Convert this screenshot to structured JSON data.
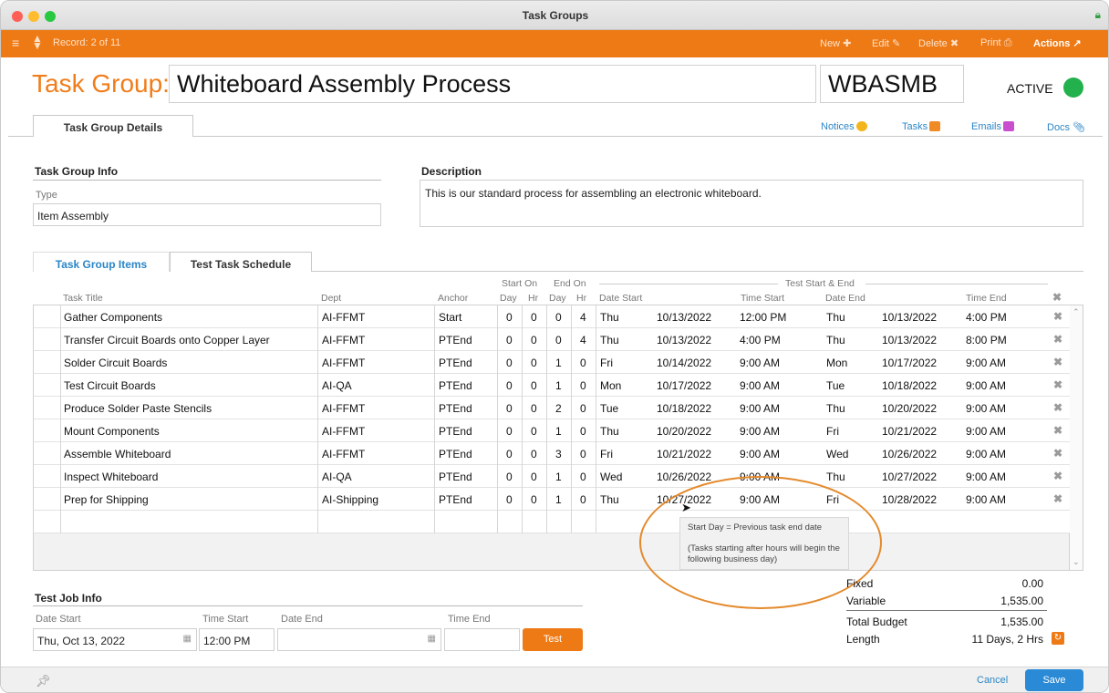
{
  "window": {
    "title": "Task Groups"
  },
  "toolbar": {
    "record": "Record: 2 of 11",
    "new": "New",
    "edit": "Edit",
    "delete": "Delete",
    "print": "Print",
    "actions": "Actions"
  },
  "header": {
    "label": "Task Group:",
    "name": "Whiteboard Assembly Process",
    "code": "WBASMB",
    "status": "ACTIVE",
    "status_color": "#22b14c"
  },
  "tabs": {
    "details": "Task Group Details"
  },
  "links": {
    "notices": "Notices",
    "tasks": "Tasks",
    "emails": "Emails",
    "docs": "Docs"
  },
  "info": {
    "section": "Task Group Info",
    "type_label": "Type",
    "type_value": "Item Assembly"
  },
  "description": {
    "section": "Description",
    "text": "This is our standard process for assembling an electronic whiteboard."
  },
  "subtabs": {
    "items": "Task Group Items",
    "schedule": "Test Task Schedule"
  },
  "grid": {
    "group_start": "Start On",
    "group_end": "End On",
    "group_test": "Test Start & End",
    "columns": {
      "title": "Task Title",
      "dept": "Dept",
      "anchor": "Anchor",
      "sday": "Day",
      "shr": "Hr",
      "eday": "Day",
      "ehr": "Hr",
      "date_start": "Date Start",
      "time_start": "Time Start",
      "date_end": "Date End",
      "time_end": "Time End"
    },
    "rows": [
      {
        "title": "Gather Components",
        "dept": "AI-FFMT",
        "anchor": "Start",
        "sday": "0",
        "shr": "0",
        "eday": "0",
        "ehr": "4",
        "sdow": "Thu",
        "sdate": "10/13/2022",
        "stime": "12:00 PM",
        "edow": "Thu",
        "edate": "10/13/2022",
        "etime": "4:00 PM"
      },
      {
        "title": "Transfer Circuit Boards onto Copper Layer",
        "dept": "AI-FFMT",
        "anchor": "PTEnd",
        "sday": "0",
        "shr": "0",
        "eday": "0",
        "ehr": "4",
        "sdow": "Thu",
        "sdate": "10/13/2022",
        "stime": "4:00 PM",
        "edow": "Thu",
        "edate": "10/13/2022",
        "etime": "8:00 PM"
      },
      {
        "title": "Solder Circuit Boards",
        "dept": "AI-FFMT",
        "anchor": "PTEnd",
        "sday": "0",
        "shr": "0",
        "eday": "1",
        "ehr": "0",
        "sdow": "Fri",
        "sdate": "10/14/2022",
        "stime": "9:00 AM",
        "edow": "Mon",
        "edate": "10/17/2022",
        "etime": "9:00 AM"
      },
      {
        "title": "Test Circuit Boards",
        "dept": "AI-QA",
        "anchor": "PTEnd",
        "sday": "0",
        "shr": "0",
        "eday": "1",
        "ehr": "0",
        "sdow": "Mon",
        "sdate": "10/17/2022",
        "stime": "9:00 AM",
        "edow": "Tue",
        "edate": "10/18/2022",
        "etime": "9:00 AM"
      },
      {
        "title": "Produce Solder Paste Stencils",
        "dept": "AI-FFMT",
        "anchor": "PTEnd",
        "sday": "0",
        "shr": "0",
        "eday": "2",
        "ehr": "0",
        "sdow": "Tue",
        "sdate": "10/18/2022",
        "stime": "9:00 AM",
        "edow": "Thu",
        "edate": "10/20/2022",
        "etime": "9:00 AM"
      },
      {
        "title": "Mount Components",
        "dept": "AI-FFMT",
        "anchor": "PTEnd",
        "sday": "0",
        "shr": "0",
        "eday": "1",
        "ehr": "0",
        "sdow": "Thu",
        "sdate": "10/20/2022",
        "stime": "9:00 AM",
        "edow": "Fri",
        "edate": "10/21/2022",
        "etime": "9:00 AM"
      },
      {
        "title": "Assemble Whiteboard",
        "dept": "AI-FFMT",
        "anchor": "PTEnd",
        "sday": "0",
        "shr": "0",
        "eday": "3",
        "ehr": "0",
        "sdow": "Fri",
        "sdate": "10/21/2022",
        "stime": "9:00 AM",
        "edow": "Wed",
        "edate": "10/26/2022",
        "etime": "9:00 AM"
      },
      {
        "title": "Inspect Whiteboard",
        "dept": "AI-QA",
        "anchor": "PTEnd",
        "sday": "0",
        "shr": "0",
        "eday": "1",
        "ehr": "0",
        "sdow": "Wed",
        "sdate": "10/26/2022",
        "stime": "9:00 AM",
        "edow": "Thu",
        "edate": "10/27/2022",
        "etime": "9:00 AM"
      },
      {
        "title": "Prep for Shipping",
        "dept": "AI-Shipping",
        "anchor": "PTEnd",
        "sday": "0",
        "shr": "0",
        "eday": "1",
        "ehr": "0",
        "sdow": "Thu",
        "sdate": "10/27/2022",
        "stime": "9:00 AM",
        "edow": "Fri",
        "edate": "10/28/2022",
        "etime": "9:00 AM"
      }
    ]
  },
  "tooltip": {
    "line1": "Start Day = Previous task end date",
    "line2": "(Tasks starting after hours will begin the following business day)"
  },
  "job": {
    "section": "Test Job Info",
    "date_start_label": "Date Start",
    "date_start": "Thu, Oct 13, 2022",
    "time_start_label": "Time Start",
    "time_start": "12:00 PM",
    "date_end_label": "Date End",
    "time_end_label": "Time End",
    "test_button": "Test"
  },
  "budget": {
    "fixed_label": "Fixed",
    "fixed": "0.00",
    "variable_label": "Variable",
    "variable": "1,535.00",
    "total_label": "Total Budget",
    "total": "1,535.00",
    "length_label": "Length",
    "length": "11 Days, 2 Hrs"
  },
  "footer": {
    "cancel": "Cancel",
    "save": "Save"
  }
}
